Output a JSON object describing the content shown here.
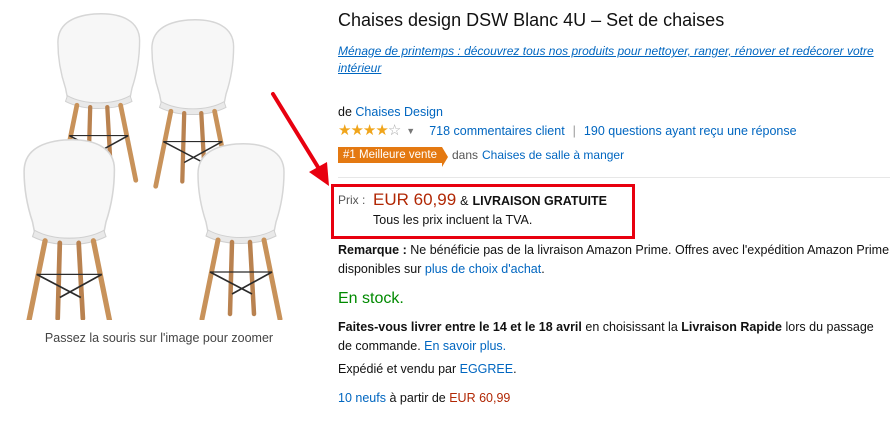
{
  "product": {
    "title": "Chaises design DSW Blanc 4U – Set de chaises",
    "promo_link": "Ménage de printemps : découvrez tous nos produits pour nettoyer, ranger, rénover et redécorer votre intérieur",
    "byline_prefix": "de",
    "brand": "Chaises Design",
    "rating_stars": 4,
    "reviews_link": "718 commentaires client",
    "questions_link": "190 questions ayant reçu une réponse",
    "bestseller_badge": "#1 Meilleure vente",
    "badge_category_prefix": "dans",
    "badge_category_link": "Chaises de salle à manger"
  },
  "image": {
    "zoom_hint": "Passez la souris sur l'image pour zoomer"
  },
  "price": {
    "label": "Prix :",
    "amount": "EUR 60,99",
    "amp": "&",
    "free_shipping": "LIVRAISON GRATUITE",
    "vat_note": "Tous les prix incluent la TVA."
  },
  "remark": {
    "label": "Remarque :",
    "text": "Ne bénéficie pas de la livraison Amazon Prime. Offres avec l'expédition Amazon Prime disponibles sur",
    "link": "plus de choix d'achat",
    "end": "."
  },
  "stock": "En stock.",
  "delivery": {
    "bold_part": "Faites-vous livrer entre le 14 et le 18 avril",
    "middle": "en choisissant la",
    "bold_option": "Livraison Rapide",
    "after": "lors du passage de commande.",
    "link": "En savoir plus."
  },
  "seller": {
    "prefix": "Expédié et vendu par",
    "name": "EGGREE",
    "end": "."
  },
  "offers": {
    "link": "10 neufs",
    "middle": "à partir de",
    "price": "EUR 60,99"
  },
  "colors": {
    "link": "#0066c0",
    "price": "#b12704",
    "stock": "#008a00",
    "badge": "#e47911",
    "highlight_box": "#e8000f",
    "star": "#f0a51c"
  }
}
